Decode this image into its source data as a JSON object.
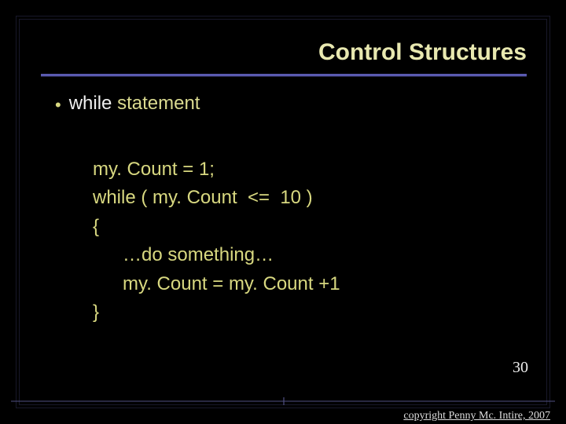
{
  "title": "Control Structures",
  "bullet": {
    "prefix": "while",
    "rest": " statement"
  },
  "code": {
    "l1": "my. Count = 1;",
    "l2": "while ( my. Count  <=  10 )",
    "l3": "{",
    "l4": "…do something…",
    "l5": "my. Count = my. Count +1",
    "l6": "}"
  },
  "slide_number": "30",
  "copyright": "copyright Penny Mc. Intire, 2007"
}
